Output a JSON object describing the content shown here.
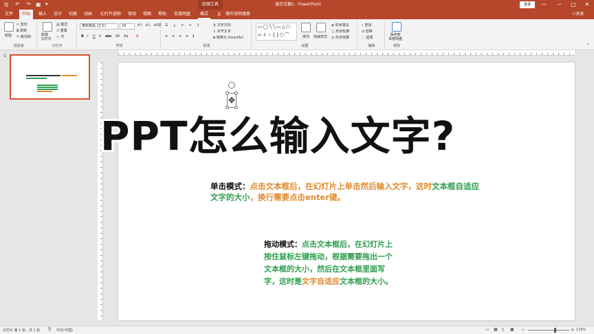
{
  "titlebar": {
    "title": "演示文稿1 - PowerPoint",
    "context_label": "绘图工具",
    "login_label": "登录",
    "min": "─",
    "max": "□",
    "close": "✕"
  },
  "tabs": [
    "文件",
    "开始",
    "插入",
    "设计",
    "切换",
    "动画",
    "幻灯片放映",
    "审阅",
    "视图",
    "帮助",
    "百度网盘",
    "格式"
  ],
  "tell_me": "操作说明搜索",
  "share": "共享",
  "ribbon": {
    "clipboard": {
      "label": "剪贴板",
      "paste": "粘贴",
      "cut": "剪切",
      "copy": "复制",
      "format_painter": "格式刷"
    },
    "slides": {
      "label": "幻灯片",
      "new_slide": "新建\n幻灯片",
      "layout": "版式",
      "reset": "重置",
      "section": "节"
    },
    "font": {
      "label": "字体",
      "font_name": "微软雅黑 (正文)",
      "font_size": "18"
    },
    "paragraph": {
      "label": "段落",
      "text_direction": "文字方向",
      "align_text": "对齐文本",
      "smartart": "转换为 SmartArt"
    },
    "drawing": {
      "label": "绘图",
      "arrange": "排列",
      "quick_styles": "快速样式",
      "shape_fill": "形状填充",
      "shape_outline": "形状轮廓",
      "shape_effects": "形状效果"
    },
    "editing": {
      "label": "编辑",
      "find": "查找",
      "replace": "替换",
      "select": "选择"
    },
    "save": {
      "label": "保存",
      "save_baidu": "保存到\n百度网盘"
    }
  },
  "slide_panel": {
    "number": "1"
  },
  "slide": {
    "title": "PPT怎么输入文字?",
    "p1_bold": "单击模式：",
    "p1_orange": "点击文本框后，在幻灯片上单击然后输入文字，这时",
    "p1_green1": "文本框自适应",
    "p1_green2": "文字的大小",
    "p1_rest": "，换行需要点击enter键。",
    "p2_bold": "拖动模式：",
    "p2_green": "点击文本框后，在幻灯片上按住鼠标左键拖动，根据需要拖出一个文本框的大小，然后在文本框里面写字，这时是",
    "p2_orange": "文字自适应",
    "p2_green2": "文本框的大小。"
  },
  "statusbar": {
    "slide_info": "幻灯片 第 1 张，共 1 张",
    "language": "中文(中国)",
    "zoom": "116%"
  }
}
